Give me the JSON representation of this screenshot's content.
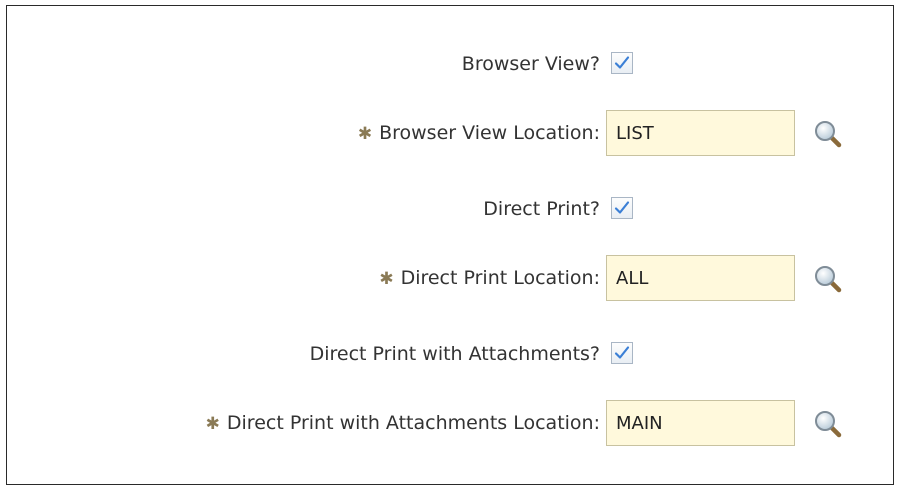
{
  "form": {
    "browser_view": {
      "label": "Browser View?",
      "checked": true
    },
    "browser_view_location": {
      "label": "Browser View Location:",
      "required_marker": "✱",
      "value": "LIST",
      "lookup_icon": "magnifier-icon"
    },
    "direct_print": {
      "label": "Direct Print?",
      "checked": true
    },
    "direct_print_location": {
      "label": "Direct Print Location:",
      "required_marker": "✱",
      "value": "ALL",
      "lookup_icon": "magnifier-icon"
    },
    "direct_print_attachments": {
      "label": "Direct Print with Attachments?",
      "checked": true
    },
    "direct_print_attachments_location": {
      "label": "Direct Print with Attachments Location:",
      "required_marker": "✱",
      "value": "MAIN",
      "lookup_icon": "magnifier-icon"
    }
  },
  "colors": {
    "input_bg": "#fff9dc",
    "checkmark": "#3b7fd6",
    "required_marker": "#8a7a55"
  }
}
